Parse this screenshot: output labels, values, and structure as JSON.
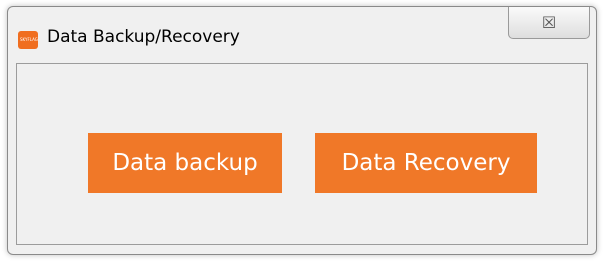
{
  "window": {
    "title": "Data Backup/Recovery",
    "app_icon": "app-logo-icon",
    "app_icon_text": "SKYFLAG",
    "close_glyph": "☒"
  },
  "buttons": {
    "backup_label": "Data backup",
    "recovery_label": "Data Recovery"
  },
  "colors": {
    "accent": "#f07828",
    "button_text": "#ffffff",
    "window_bg": "#f0f0f0"
  }
}
